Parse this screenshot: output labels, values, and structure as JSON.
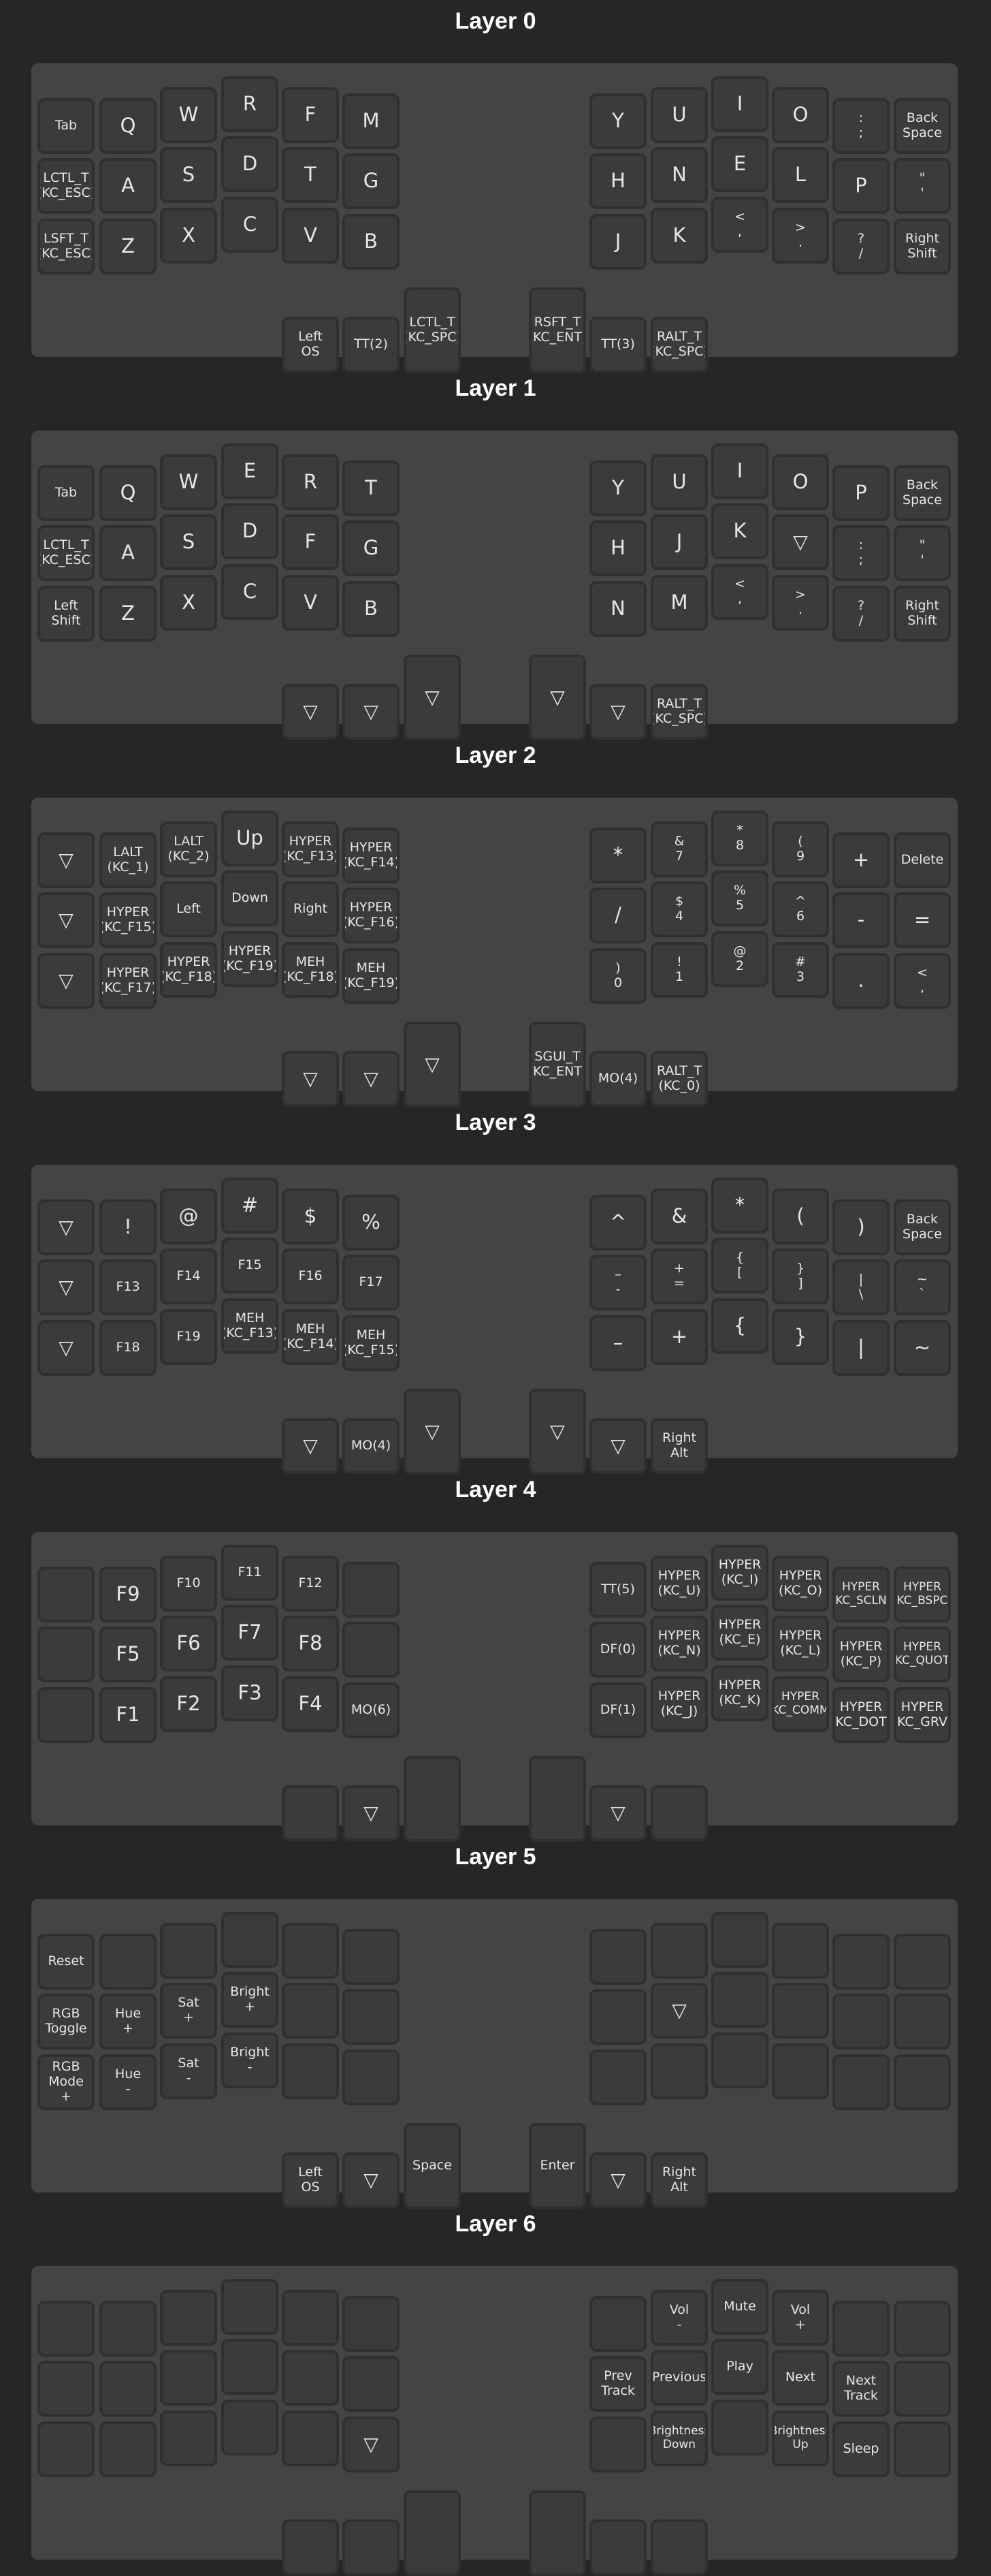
{
  "layers": [
    {
      "title": "Layer 0",
      "keys": {
        "L0": [
          "Tab",
          "Q",
          "W",
          "R",
          "F",
          "M"
        ],
        "L1": [
          "LCTL_T\n(KC_ESC)",
          "A",
          "S",
          "D",
          "T",
          "G"
        ],
        "L2": [
          "LSFT_T\n(KC_ESC)",
          "Z",
          "X",
          "C",
          "V",
          "B"
        ],
        "R0": [
          "Y",
          "U",
          "I",
          "O",
          ":\n;",
          "Back\nSpace"
        ],
        "R1": [
          "H",
          "N",
          "E",
          "L",
          "P",
          "\"\n'"
        ],
        "R2": [
          "J",
          "K",
          "<\n,",
          ">\n.",
          "?\n/",
          "Right\nShift"
        ],
        "LT": [
          "Left\nOS",
          "TT(2)",
          "LCTL_T\n(KC_SPC)"
        ],
        "RT": [
          "RSFT_T\n(KC_ENT)",
          "TT(3)",
          "RALT_T\n(KC_SPC)"
        ]
      }
    },
    {
      "title": "Layer 1",
      "keys": {
        "L0": [
          "Tab",
          "Q",
          "W",
          "E",
          "R",
          "T"
        ],
        "L1": [
          "LCTL_T\n(KC_ESC)",
          "A",
          "S",
          "D",
          "F",
          "G"
        ],
        "L2": [
          "Left\nShift",
          "Z",
          "X",
          "C",
          "V",
          "B"
        ],
        "R0": [
          "Y",
          "U",
          "I",
          "O",
          "P",
          "Back\nSpace"
        ],
        "R1": [
          "H",
          "J",
          "K",
          "▽",
          ":\n;",
          "\"\n'"
        ],
        "R2": [
          "N",
          "M",
          "<\n,",
          ">\n.",
          "?\n/",
          "Right\nShift"
        ],
        "LT": [
          "▽",
          "▽",
          "▽"
        ],
        "RT": [
          "▽",
          "▽",
          "RALT_T\n(KC_SPC)"
        ]
      }
    },
    {
      "title": "Layer 2",
      "keys": {
        "L0": [
          "▽",
          "LALT\n(KC_1)",
          "LALT\n(KC_2)",
          "Up",
          "HYPER\n(KC_F13)",
          "HYPER\n(KC_F14)"
        ],
        "L1": [
          "▽",
          "HYPER\n(KC_F15)",
          "Left",
          "Down",
          "Right",
          "HYPER\n(KC_F16)"
        ],
        "L2": [
          "▽",
          "HYPER\n(KC_F17)",
          "HYPER\n(KC_F18)",
          "HYPER\n(KC_F19)",
          "MEH\n(KC_F18)",
          "MEH\n(KC_F19)"
        ],
        "R0": [
          "*",
          "&\n7",
          "*\n8",
          "(\n9",
          "+",
          "Delete"
        ],
        "R1": [
          "/",
          "$\n4",
          "%\n5",
          "^\n6",
          "-",
          "="
        ],
        "R2": [
          ")\n0",
          "!\n1",
          "@\n2",
          "#\n3",
          ".",
          "<\n,"
        ],
        "LT": [
          "▽",
          "▽",
          "▽"
        ],
        "RT": [
          "SGUI_T\n(KC_ENT)",
          "MO(4)",
          "RALT_T\n(KC_0)"
        ]
      }
    },
    {
      "title": "Layer 3",
      "keys": {
        "L0": [
          "▽",
          "!",
          "@",
          "#",
          "$",
          "%"
        ],
        "L1": [
          "▽",
          "F13",
          "F14",
          "F15",
          "F16",
          "F17"
        ],
        "L2": [
          "▽",
          "F18",
          "F19",
          "MEH\n(KC_F13)",
          "MEH\n(KC_F14)",
          "MEH\n(KC_F15)"
        ],
        "R0": [
          "^",
          "&",
          "*",
          "(",
          ")",
          "Back\nSpace"
        ],
        "R1": [
          "–\n-",
          "+\n=",
          "{\n[",
          "}\n]",
          "|\n\\",
          "~\n`"
        ],
        "R2": [
          "–",
          "+",
          "{",
          "}",
          "|",
          "~"
        ],
        "LT": [
          "▽",
          "MO(4)",
          "▽"
        ],
        "RT": [
          "▽",
          "▽",
          "Right\nAlt"
        ]
      }
    },
    {
      "title": "Layer 4",
      "keys": {
        "L0": [
          "",
          "F9",
          "F10",
          "F11",
          "F12",
          ""
        ],
        "L1": [
          "",
          "F5",
          "F6",
          "F7",
          "F8",
          ""
        ],
        "L2": [
          "",
          "F1",
          "F2",
          "F3",
          "F4",
          "MO(6)"
        ],
        "R0": [
          "TT(5)",
          "HYPER\n(KC_U)",
          "HYPER\n(KC_I)",
          "HYPER\n(KC_O)",
          "HYPER\n(KC_SCLN)",
          "HYPER\n(KC_BSPC)"
        ],
        "R1": [
          "DF(0)",
          "HYPER\n(KC_N)",
          "HYPER\n(KC_E)",
          "HYPER\n(KC_L)",
          "HYPER\n(KC_P)",
          "HYPER\n(KC_QUOT)"
        ],
        "R2": [
          "DF(1)",
          "HYPER\n(KC_J)",
          "HYPER\n(KC_K)",
          "HYPER\n(KC_COMM)",
          "HYPER\n(KC_DOT)",
          "HYPER\n(KC_GRV)"
        ],
        "LT": [
          "",
          "▽",
          ""
        ],
        "RT": [
          "",
          "▽",
          ""
        ]
      }
    },
    {
      "title": "Layer 5",
      "keys": {
        "L0": [
          "Reset",
          "",
          "",
          "",
          "",
          ""
        ],
        "L1": [
          "RGB\nToggle",
          "Hue\n+",
          "Sat\n+",
          "Bright\n+",
          "",
          ""
        ],
        "L2": [
          "RGB\nMode\n+",
          "Hue\n-",
          "Sat\n-",
          "Bright\n-",
          "",
          ""
        ],
        "R0": [
          "",
          "",
          "",
          "",
          "",
          ""
        ],
        "R1": [
          "",
          "▽",
          "",
          "",
          "",
          ""
        ],
        "R2": [
          "",
          "",
          "",
          "",
          "",
          ""
        ],
        "LT": [
          "Left\nOS",
          "▽",
          "Space"
        ],
        "RT": [
          "Enter",
          "▽",
          "Right\nAlt"
        ]
      }
    },
    {
      "title": "Layer 6",
      "keys": {
        "L0": [
          "",
          "",
          "",
          "",
          "",
          ""
        ],
        "L1": [
          "",
          "",
          "",
          "",
          "",
          ""
        ],
        "L2": [
          "",
          "",
          "",
          "",
          "",
          "▽"
        ],
        "R0": [
          "",
          "Vol\n-",
          "Mute",
          "Vol\n+",
          "",
          ""
        ],
        "R1": [
          "Prev\nTrack",
          "Previous",
          "Play",
          "Next",
          "Next\nTrack",
          ""
        ],
        "R2": [
          "",
          "Brightness\nDown",
          "",
          "Brightness\nUp",
          "Sleep",
          ""
        ],
        "LT": [
          "",
          "",
          ""
        ],
        "RT": [
          "",
          "",
          ""
        ]
      }
    }
  ]
}
